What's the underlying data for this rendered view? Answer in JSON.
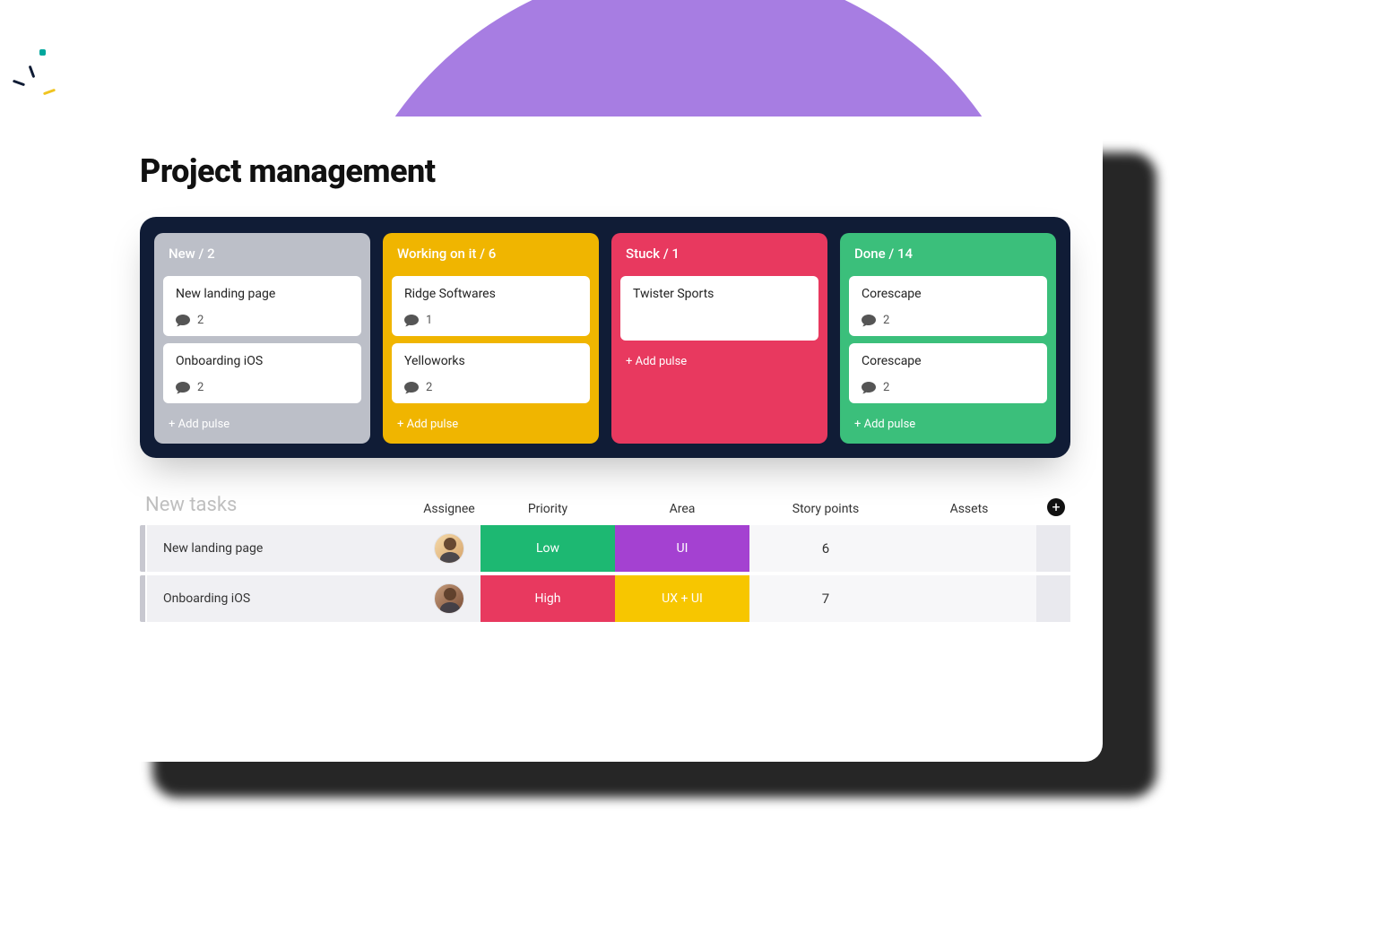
{
  "page_title": "Project management",
  "colors": {
    "accent_purple": "#a77de2",
    "board_bg": "#101c36",
    "col_new": "#bcbfc8",
    "col_working": "#f0b500",
    "col_stuck": "#e8395f",
    "col_done": "#3bbf7b",
    "prio_low": "#1db872",
    "prio_high": "#e8395f",
    "area_ui": "#a441d1",
    "area_uxui": "#f7c600"
  },
  "board": {
    "columns": [
      {
        "id": "new",
        "title": "New",
        "count": 2,
        "add_label": "+ Add pulse",
        "cards": [
          {
            "title": "New landing page",
            "comments": 2
          },
          {
            "title": "Onboarding iOS",
            "comments": 2
          }
        ]
      },
      {
        "id": "working",
        "title": "Working on it",
        "count": 6,
        "add_label": "+ Add pulse",
        "cards": [
          {
            "title": "Ridge Softwares",
            "comments": 1
          },
          {
            "title": "Yelloworks",
            "comments": 2
          }
        ]
      },
      {
        "id": "stuck",
        "title": "Stuck",
        "count": 1,
        "add_label": "+ Add pulse",
        "cards": [
          {
            "title": "Twister Sports"
          }
        ]
      },
      {
        "id": "done",
        "title": "Done",
        "count": 14,
        "add_label": "+ Add pulse",
        "cards": [
          {
            "title": "Corescape",
            "comments": 2
          },
          {
            "title": "Corescape",
            "comments": 2
          }
        ]
      }
    ]
  },
  "task_table": {
    "section_title": "New tasks",
    "headers": {
      "assignee": "Assignee",
      "priority": "Priority",
      "area": "Area",
      "points": "Story points",
      "assets": "Assets"
    },
    "rows": [
      {
        "name": "New landing page",
        "priority": {
          "label": "Low",
          "color_key": "prio_low"
        },
        "area": {
          "label": "UI",
          "color_key": "area_ui"
        },
        "points": 6
      },
      {
        "name": "Onboarding iOS",
        "priority": {
          "label": "High",
          "color_key": "prio_high"
        },
        "area": {
          "label": "UX + UI",
          "color_key": "area_uxui"
        },
        "points": 7
      }
    ]
  }
}
